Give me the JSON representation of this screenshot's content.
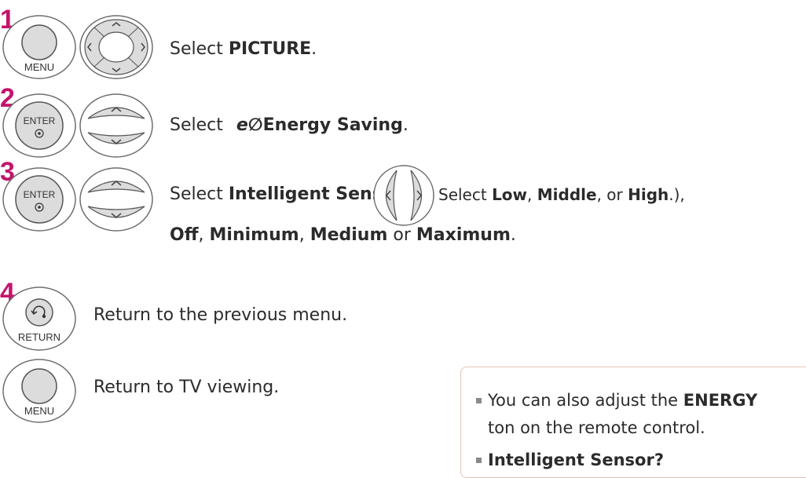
{
  "steps": [
    {
      "number": "1",
      "button_label": "MENU",
      "text": {
        "pre": "Select ",
        "b1": "PICTURE",
        "post": "."
      }
    },
    {
      "number": "2",
      "button_label": "ENTER",
      "text": {
        "pre": "Select ",
        "icon": "e∅",
        "b1": "Energy Saving",
        "post": "."
      }
    },
    {
      "number": "3",
      "button_label": "ENTER",
      "line1": {
        "pre": "Select ",
        "b1": "Intelligent Sensor",
        "open": " (",
        "sub_pre": "Select ",
        "s1": "Low",
        "c1": ", ",
        "s2": "Middle",
        "c2": ", or ",
        "s3": "High",
        "close": ".),"
      },
      "line2": {
        "b1": "Off",
        "c1": ", ",
        "b2": "Minimum",
        "c2": ", ",
        "b3": "Medium",
        "c3": " or ",
        "b4": "Maximum",
        "post": "."
      }
    },
    {
      "number": "4",
      "button_label": "RETURN",
      "text": "Return to the previous menu.",
      "sub": {
        "button_label": "MENU",
        "text": "Return to TV viewing."
      }
    }
  ],
  "note": {
    "line1_pre": "You can also adjust the ",
    "line1_b": "ENERGY",
    "line2": "ton on the remote control.",
    "line3_b": "Intelligent Sensor?"
  },
  "colors": {
    "step_number": "#c4146c",
    "button_fill": "#dcdcdc",
    "note_border": "#e3c6b8"
  }
}
